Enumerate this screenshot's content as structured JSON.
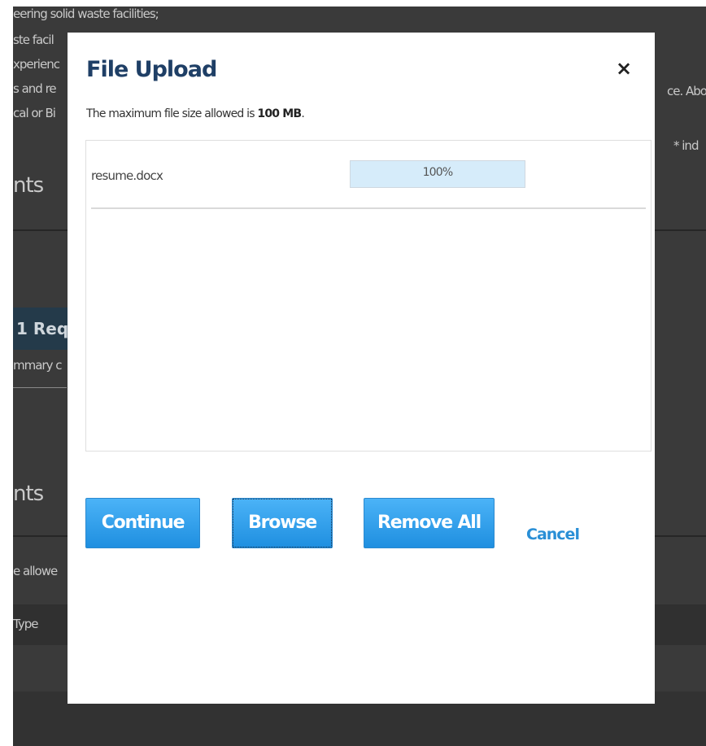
{
  "background": {
    "text_lines": [
      "eering solid waste facilities;",
      "ste facil",
      "xperienc",
      "s and re",
      "cal or Bi",
      "ce. Abo",
      "* ind",
      "mmary c",
      "e allowe",
      "Type"
    ],
    "headings": [
      "nts",
      "nts"
    ],
    "button_label": "1 Requ"
  },
  "dialog": {
    "title": "File Upload",
    "close_label": "×",
    "limit_text_prefix": "The maximum file size allowed is ",
    "limit_value": "100 MB",
    "limit_text_suffix": "."
  },
  "files": [
    {
      "name": "resume.docx",
      "progress_text": "100%",
      "progress": 1.0
    }
  ],
  "buttons": {
    "continue": "Continue",
    "browse": "Browse",
    "remove_all": "Remove All",
    "cancel": "Cancel"
  },
  "colors": {
    "title": "#1f3f66",
    "primary_button": "#2196e8",
    "link": "#2a8fd6",
    "progress_fill": "#d6ecfa"
  }
}
